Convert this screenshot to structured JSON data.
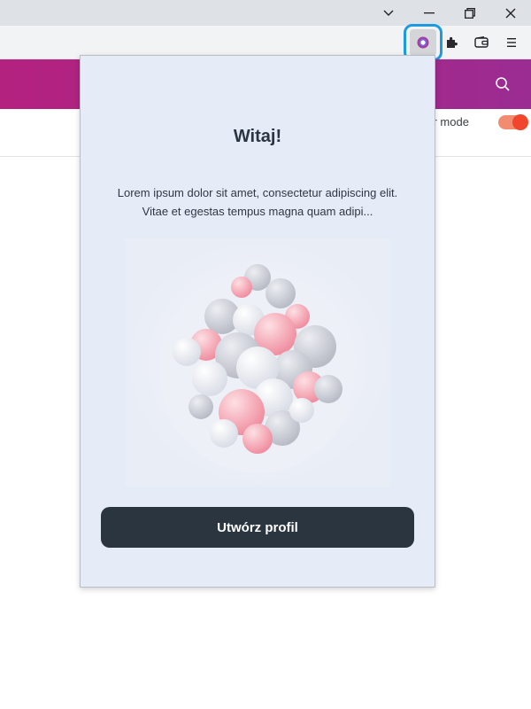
{
  "browser": {
    "titlebar_controls": [
      "tab-list-icon",
      "minimize-icon",
      "restore-icon",
      "close-icon"
    ],
    "toolbar_icons": [
      "extension-active-icon",
      "extensions-puzzle-icon",
      "wallet-icon",
      "menu-icon"
    ],
    "highlight_color": "#1c9be0"
  },
  "site": {
    "header_gradient": [
      "#b4227f",
      "#9b2c92"
    ],
    "search_icon": "search-icon",
    "mode_label": "per mode",
    "mode_toggle_on": true
  },
  "popup": {
    "title": "Witaj!",
    "description": "Lorem ipsum dolor sit amet, consectetur adipiscing elit. Vitae et egestas tempus magna quam adipi...",
    "hero_image": "abstract-3d-blobs-illustration",
    "cta_label": "Utwórz profil",
    "background": "#e5ebf7",
    "cta_color": "#2a3540"
  }
}
